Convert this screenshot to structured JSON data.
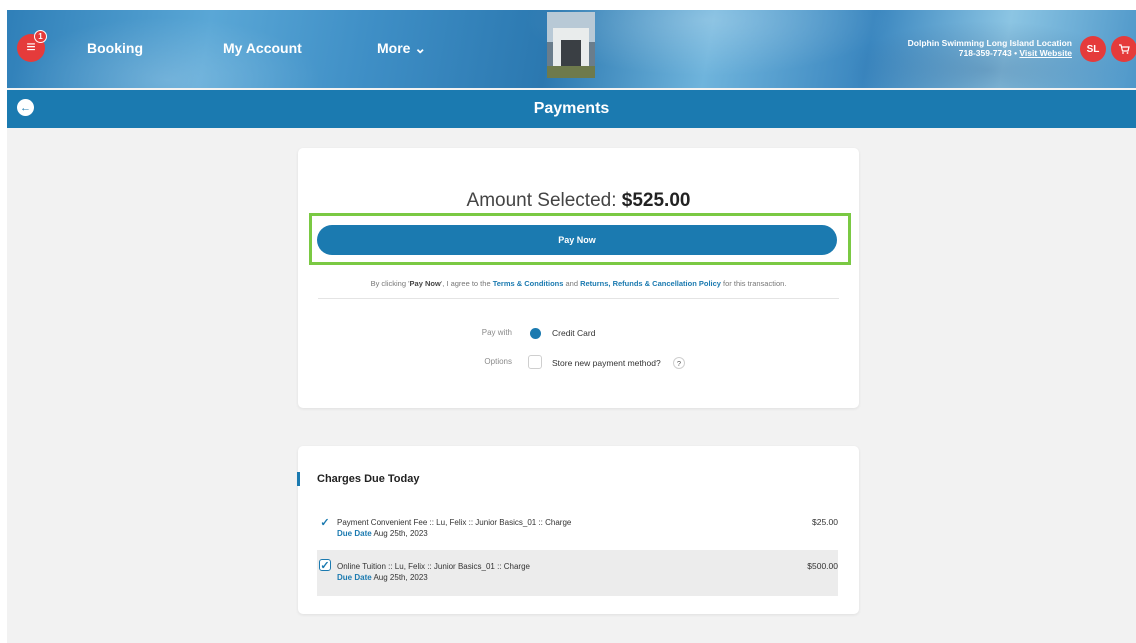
{
  "header": {
    "menu_icon": "menu-icon",
    "menu_badge": "1",
    "nav": {
      "booking": "Booking",
      "my_account": "My Account",
      "more": "More"
    },
    "more_chevron": "⌄",
    "location_name": "Dolphin Swimming Long Island Location",
    "location_phone": "718-359-7743",
    "location_sep": " • ",
    "visit_website": "Visit Website",
    "avatar_initials": "SL",
    "cart_icon": "cart-icon"
  },
  "titlebar": {
    "back_icon": "arrow-left-icon",
    "title": "Payments"
  },
  "payment": {
    "amount_label": "Amount Selected: ",
    "amount_value": "$525.00",
    "pay_now": "Pay Now",
    "terms_pre": "By clicking '",
    "terms_bold": "Pay Now",
    "terms_mid": "', I agree to the ",
    "terms_link1": "Terms & Conditions",
    "terms_and": " and ",
    "terms_link2": "Returns, Refunds & Cancellation Policy",
    "terms_post": " for this transaction.",
    "pay_with_label": "Pay with",
    "pay_with_value": "Credit Card",
    "options_label": "Options",
    "store_label": "Store new payment method?",
    "help": "?"
  },
  "charges": {
    "title": "Charges Due Today",
    "items": [
      {
        "desc": "Payment Convenient Fee :: Lu, Felix :: Junior Basics_01 :: Charge",
        "due_key": "Due Date",
        "due_val": " Aug 25th, 2023",
        "amount": "$25.00"
      },
      {
        "desc": "Online Tuition :: Lu, Felix :: Junior Basics_01 :: Charge",
        "due_key": "Due Date",
        "due_val": " Aug 25th, 2023",
        "amount": "$500.00"
      }
    ]
  },
  "colors": {
    "brand": "#1b7ab0",
    "accent_red": "#e53b3b",
    "highlight": "#7ac943"
  }
}
